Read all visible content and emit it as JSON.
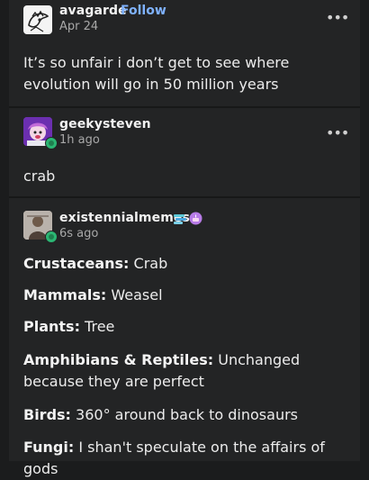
{
  "posts": [
    {
      "username": "avagarde",
      "follow_label": "Follow",
      "time": "Apr 24",
      "menu": "•••",
      "text": "It’s so unfair i don’t get to see where evolution will go in 50 million years"
    },
    {
      "username": "geekysteven",
      "time": "1h ago",
      "menu": "•••",
      "text": "crab"
    },
    {
      "username": "existennialmemes",
      "time": "6s ago",
      "lines": [
        {
          "label": "Crustaceans:",
          "value": " Crab"
        },
        {
          "label": "Mammals:",
          "value": " Weasel"
        },
        {
          "label": "Plants:",
          "value": " Tree"
        },
        {
          "label": "Amphibians & Reptiles:",
          "value": " Unchanged because they are perfect"
        },
        {
          "label": "Birds:",
          "value": " 360° around back to dinosaurs"
        },
        {
          "label": "Fungi:",
          "value": " I shan't speculate on the affairs of gods"
        }
      ]
    }
  ],
  "colors": {
    "background": "#1b1c1d",
    "card": "#232425",
    "link": "#7fb2ff",
    "badge": "#2bb673"
  },
  "icons": {
    "menu": "ellipsis-icon",
    "badge": "sideblog-badge-icon"
  }
}
